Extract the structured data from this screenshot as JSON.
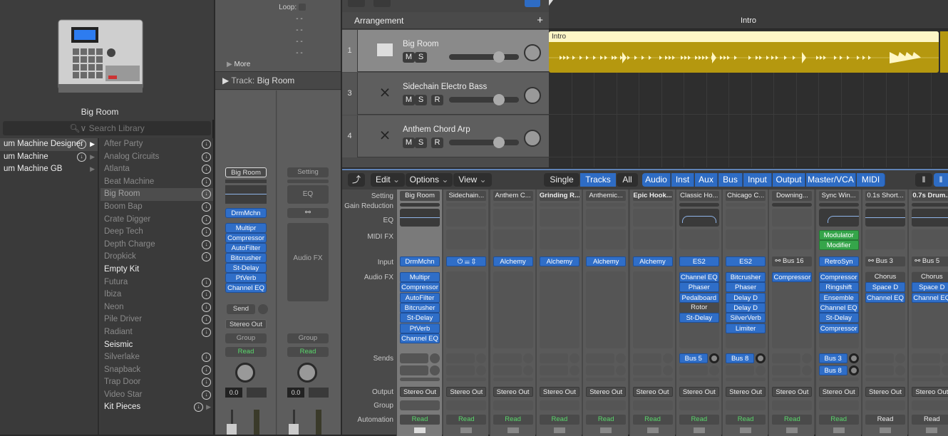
{
  "library": {
    "preview_title": "Big Room",
    "search_placeholder": "Search Library",
    "column1": [
      {
        "label": "um Machine Designer",
        "download": true,
        "arrow": true,
        "selected": true
      },
      {
        "label": "um Machine",
        "download": true,
        "arrow": true
      },
      {
        "label": "um Machine GB",
        "download": false,
        "arrow": true
      }
    ],
    "column2": [
      {
        "label": "After Party",
        "download": true
      },
      {
        "label": "Analog Circuits",
        "download": true
      },
      {
        "label": "Atlanta",
        "download": true
      },
      {
        "label": "Beat Machine",
        "download": true
      },
      {
        "label": "Big Room",
        "download": true,
        "highlighted": true
      },
      {
        "label": "Boom Bap",
        "download": true
      },
      {
        "label": "Crate Digger",
        "download": true
      },
      {
        "label": "Deep Tech",
        "download": true
      },
      {
        "label": "Depth Charge",
        "download": true
      },
      {
        "label": "Dropkick",
        "download": true
      },
      {
        "label": "Empty Kit",
        "download": false,
        "white": true
      },
      {
        "label": "Futura",
        "download": true
      },
      {
        "label": "Ibiza",
        "download": true
      },
      {
        "label": "Neon",
        "download": true
      },
      {
        "label": "Pile Driver",
        "download": true
      },
      {
        "label": "Radiant",
        "download": true
      },
      {
        "label": "Seismic",
        "download": false,
        "white": true
      },
      {
        "label": "Silverlake",
        "download": true
      },
      {
        "label": "Snapback",
        "download": true
      },
      {
        "label": "Trap Door",
        "download": true
      },
      {
        "label": "Video Star",
        "download": true
      },
      {
        "label": "Kit Pieces",
        "download": true,
        "white": true,
        "arrow": true
      }
    ]
  },
  "inspector": {
    "loop_label": "Loop:",
    "dash_rows": [
      "- -",
      "- -",
      "- -",
      "- -"
    ],
    "more_label": "More",
    "track_label": "Track:",
    "track_name": "Big Room",
    "strip1": {
      "setting": "Big Room",
      "input": "DrmMchn",
      "audio_fx": [
        "Multipr",
        "Compressor",
        "AutoFilter",
        "Bitcrusher",
        "St-Delay",
        "PtVerb",
        "Channel EQ"
      ],
      "send": "Send",
      "output": "Stereo Out",
      "group": "Group",
      "automation": "Read",
      "volume": "0.0"
    },
    "strip2": {
      "setting": "Setting",
      "eq": "EQ",
      "audio_fx": "Audio FX",
      "group": "Group",
      "automation": "Read",
      "volume": "0.0"
    }
  },
  "tracks": {
    "header": "Arrangement",
    "add_label": "+",
    "items": [
      {
        "number": "1",
        "name": "Big Room",
        "buttons": [
          "M",
          "S"
        ],
        "icon": "drum-machine-icon",
        "selected": true
      },
      {
        "number": "3",
        "name": "Sidechain Electro Bass",
        "buttons": [
          "M",
          "S",
          "R"
        ],
        "icon": "keyboard-stand-icon"
      },
      {
        "number": "4",
        "name": "Anthem Chord Arp",
        "buttons": [
          "M",
          "S",
          "R"
        ],
        "icon": "keyboard-stand-icon"
      }
    ]
  },
  "timeline": {
    "marker": "Intro",
    "region_name": "Intro"
  },
  "mixer": {
    "menus": [
      "Edit",
      "Options",
      "View"
    ],
    "view_modes": [
      {
        "label": "Single"
      },
      {
        "label": "Tracks",
        "active": true
      },
      {
        "label": "All"
      }
    ],
    "filters": [
      "Audio",
      "Inst",
      "Aux",
      "Bus",
      "Input",
      "Output",
      "Master/VCA",
      "MIDI"
    ],
    "row_labels": {
      "setting": "Setting",
      "gain_reduction": "Gain Reduction",
      "eq": "EQ",
      "midi_fx": "MIDI FX",
      "input": "Input",
      "audio_fx": "Audio FX",
      "sends": "Sends",
      "output": "Output",
      "group": "Group",
      "automation": "Automation"
    },
    "strips": [
      {
        "setting": "Big Room",
        "input": "DrmMchn",
        "input_type": "blue",
        "audio_fx": [
          "Multipr",
          "Compressor",
          "AutoFilter",
          "Bitcrusher",
          "St-Delay",
          "PtVerb",
          "Channel EQ"
        ],
        "sends": [],
        "output": "Stereo Out",
        "automation": "Read",
        "automation_green": true,
        "eq": "flat"
      },
      {
        "setting": "Sidechain...",
        "input": "",
        "input_type": "controls",
        "audio_fx": [],
        "sends": [],
        "output": "Stereo Out",
        "automation": "Read",
        "automation_green": true
      },
      {
        "setting": "Anthem C...",
        "input": "Alchemy",
        "input_type": "blue",
        "audio_fx": [],
        "sends": [],
        "output": "Stereo Out",
        "automation": "Read",
        "automation_green": true
      },
      {
        "setting": "Grinding R...",
        "input": "Alchemy",
        "input_type": "blue",
        "audio_fx": [],
        "sends": [],
        "output": "Stereo Out",
        "automation": "Read",
        "automation_green": true,
        "bold": true
      },
      {
        "setting": "Anthemic...",
        "input": "Alchemy",
        "input_type": "blue",
        "audio_fx": [],
        "sends": [],
        "output": "Stereo Out",
        "automation": "Read",
        "automation_green": true
      },
      {
        "setting": "Epic Hook...",
        "input": "Alchemy",
        "input_type": "blue",
        "audio_fx": [],
        "sends": [],
        "output": "Stereo Out",
        "automation": "Read",
        "automation_green": true,
        "bold": true
      },
      {
        "setting": "Classic Ho...",
        "input": "ES2",
        "input_type": "blue",
        "audio_fx": [
          "Channel EQ",
          "Phaser",
          "Pedalboard",
          "Rotor",
          "St-Delay"
        ],
        "bypassed_fx": [
          "Rotor"
        ],
        "sends": [
          "Bus 5"
        ],
        "output": "Stereo Out",
        "automation": "Read",
        "automation_green": true,
        "eq": "band"
      },
      {
        "setting": "Chicago C...",
        "input": "ES2",
        "input_type": "blue",
        "audio_fx": [
          "Bitcrusher",
          "Phaser",
          "Delay D",
          "Delay D",
          "SilverVerb",
          "Limiter"
        ],
        "sends": [
          "Bus 8"
        ],
        "output": "Stereo Out",
        "automation": "Read",
        "automation_green": true
      },
      {
        "setting": "Downing...",
        "input": "Bus 16",
        "input_type": "bus",
        "audio_fx": [
          "Compressor"
        ],
        "sends": [],
        "output": "Stereo Out",
        "automation": "Read",
        "automation_green": true
      },
      {
        "setting": "Sync Win...",
        "input": "RetroSyn",
        "input_type": "blue",
        "midi_fx": [
          "Modulator",
          "Modifier"
        ],
        "audio_fx": [
          "Compressor",
          "Ringshift",
          "Ensemble",
          "Channel EQ",
          "St-Delay",
          "Compressor"
        ],
        "sends": [
          "Bus 3",
          "Bus 8"
        ],
        "output": "Stereo Out",
        "automation": "Read",
        "automation_green": true,
        "eq": "hp"
      },
      {
        "setting": "0.1s Short...",
        "input": "Bus 3",
        "input_type": "bus",
        "audio_fx": [
          "Chorus",
          "Space D",
          "Channel EQ"
        ],
        "bypassed_fx": [
          "Chorus"
        ],
        "sends": [],
        "output": "Stereo Out",
        "automation": "Read",
        "automation_green": false,
        "eq": "flat"
      },
      {
        "setting": "0.7s Drum...",
        "input": "Bus 5",
        "input_type": "bus",
        "audio_fx": [
          "Chorus",
          "Space D",
          "Channel EQ"
        ],
        "bypassed_fx": [
          "Chorus"
        ],
        "sends": [],
        "output": "Stereo Out",
        "automation": "Read",
        "automation_green": false,
        "eq": "flat",
        "bold": true
      }
    ]
  },
  "colors": {
    "accent_blue": "#2f6ec8",
    "read_green": "#59d86b",
    "region_yellow": "#b5980f",
    "midi_fx_green": "#35a54a"
  }
}
